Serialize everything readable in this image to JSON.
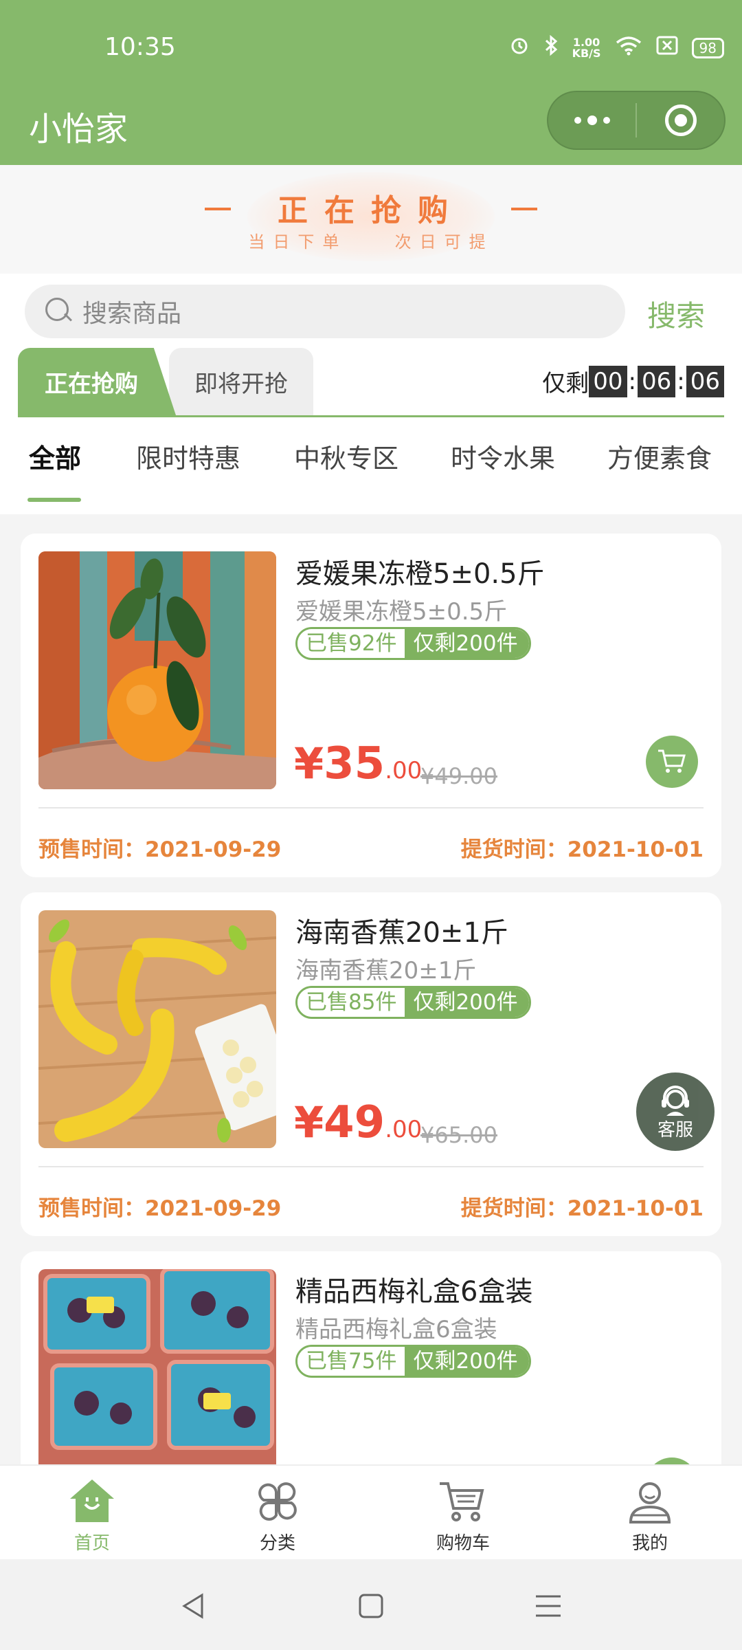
{
  "status_bar": {
    "time": "10:35",
    "speed_value": "1.00",
    "speed_unit": "KB/S",
    "battery": "98"
  },
  "header": {
    "title": "小怡家"
  },
  "banner": {
    "title": "正在抢购",
    "subtitle_left": "当日下单",
    "subtitle_right": "次日可提"
  },
  "search": {
    "placeholder": "搜索商品",
    "button": "搜索"
  },
  "sale_tabs": {
    "active": "正在抢购",
    "upcoming": "即将开抢"
  },
  "countdown": {
    "label": "仅剩",
    "hours": "00",
    "minutes": "06",
    "seconds": "06"
  },
  "categories": [
    "全部",
    "限时特惠",
    "中秋专区",
    "时令水果",
    "方便素食"
  ],
  "products": [
    {
      "name": "爱媛果冻橙5±0.5斤",
      "desc": "爱媛果冻橙5±0.5斤",
      "sold": "已售92件",
      "remaining": "仅剩200件",
      "price_symbol": "¥",
      "price_int": "35",
      "price_dec": ".00",
      "original_price": "¥49.00",
      "presale": "预售时间：2021-09-29",
      "pickup": "提货时间：2021-10-01"
    },
    {
      "name": "海南香蕉20±1斤",
      "desc": "海南香蕉20±1斤",
      "sold": "已售85件",
      "remaining": "仅剩200件",
      "price_symbol": "¥",
      "price_int": "49",
      "price_dec": ".00",
      "original_price": "¥65.00",
      "presale": "预售时间：2021-09-29",
      "pickup": "提货时间：2021-10-01"
    },
    {
      "name": "精品西梅礼盒6盒装",
      "desc": "精品西梅礼盒6盒装",
      "sold": "已售75件",
      "remaining": "仅剩200件"
    }
  ],
  "customer_service": {
    "label": "客服"
  },
  "tabbar": [
    {
      "label": "首页",
      "icon": "home-icon"
    },
    {
      "label": "分类",
      "icon": "category-icon"
    },
    {
      "label": "购物车",
      "icon": "cart-icon"
    },
    {
      "label": "我的",
      "icon": "profile-icon"
    }
  ],
  "colors": {
    "brand": "#86b96b",
    "price": "#ec4d3c",
    "accent": "#f07a3c"
  }
}
